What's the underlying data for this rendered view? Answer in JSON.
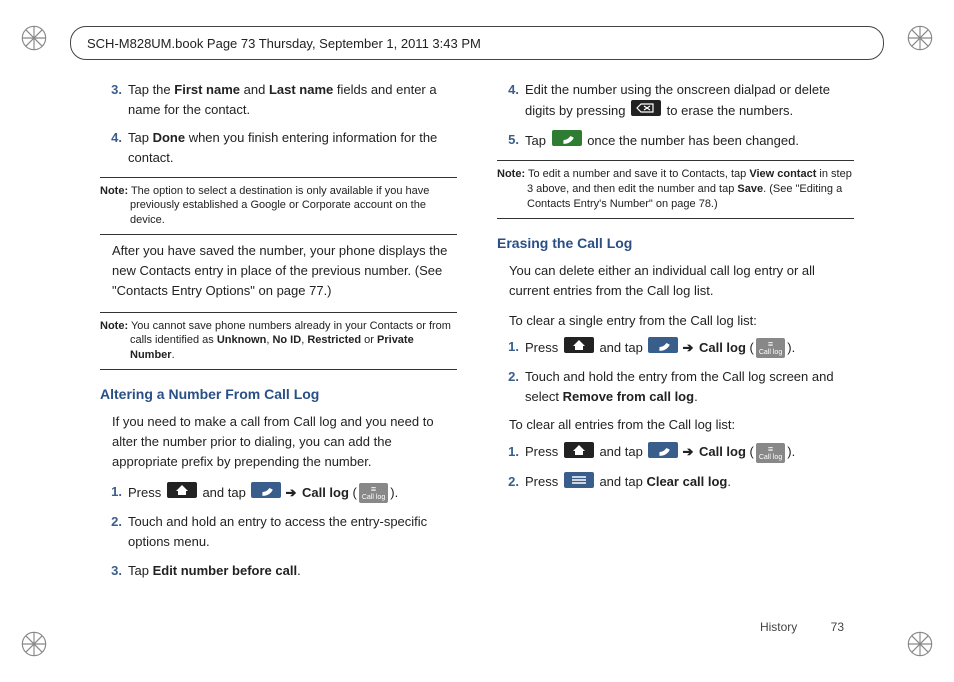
{
  "header": "SCH-M828UM.book  Page 73  Thursday, September 1, 2011  3:43 PM",
  "footer_section": "History",
  "footer_page": "73",
  "left": {
    "step3": {
      "num": "3.",
      "t1": "Tap the ",
      "b1": "First name",
      "t2": " and ",
      "b2": "Last name",
      "t3": " fields and enter a name for the contact."
    },
    "step4": {
      "num": "4.",
      "t1": "Tap ",
      "b1": "Done",
      "t2": " when you finish entering information for the contact."
    },
    "note1": {
      "lbl": "Note:",
      "t": " The option to select a destination is only available if you have previously established a Google or Corporate account on the device."
    },
    "para1": "After you have saved the number, your phone displays the new Contacts entry in place of the previous number. (See \"Contacts Entry Options\" on page 77.)",
    "note2": {
      "lbl": "Note:",
      "t1": " You cannot save phone numbers already in your Contacts or from calls identified as ",
      "b1": "Unknown",
      "c1": ", ",
      "b2": "No ID",
      "c2": ", ",
      "b3": "Restricted",
      "c3": " or ",
      "b4": "Private Number",
      "c4": "."
    },
    "h1": "Altering a Number From Call Log",
    "intro1": "If you need to make a call from Call log and you need to alter the number prior to dialing, you can add the appropriate prefix by prepending the number.",
    "s1": {
      "num": "1.",
      "t1": "Press ",
      "t2": " and tap ",
      "arrow": "➔",
      "b1": " Call log",
      "t3": " (",
      "cl": "Call log",
      "t4": ")."
    },
    "s2": {
      "num": "2.",
      "t": "Touch and hold an entry to access the entry-specific options menu."
    },
    "s3": {
      "num": "3.",
      "t1": "Tap ",
      "b1": "Edit number before call",
      "t2": "."
    }
  },
  "right": {
    "step4": {
      "num": "4.",
      "t1": "Edit the number using the onscreen dialpad or delete digits by pressing ",
      "t2": " to erase the numbers."
    },
    "step5": {
      "num": "5.",
      "t1": "Tap ",
      "t2": " once the number has been changed."
    },
    "note1": {
      "lbl": "Note:",
      "t1": " To edit a number and save it to Contacts, tap ",
      "b1": "View contact",
      "t2": " in step 3 above, and then edit the number and tap ",
      "b2": "Save",
      "t3": ". (See \"Editing a Contacts Entry's Number\" on page 78.)"
    },
    "h1": "Erasing the Call Log",
    "p1": "You can delete either an individual call log entry or all current entries from the Call log list.",
    "intro1": "To clear a single entry from the Call log list:",
    "a1": {
      "num": "1.",
      "t1": "Press ",
      "t2": " and tap ",
      "arrow": "➔",
      "b1": " Call log",
      "t3": " (",
      "cl": "Call log",
      "t4": ")."
    },
    "a2": {
      "num": "2.",
      "t1": "Touch and hold the entry from the Call log screen and select ",
      "b1": "Remove from call log",
      "t2": "."
    },
    "intro2": "To clear all entries from the Call log list:",
    "b1s": {
      "num": "1.",
      "t1": "Press ",
      "t2": " and tap ",
      "arrow": "➔",
      "b1": " Call log",
      "t3": " (",
      "cl": "Call log",
      "t4": ")."
    },
    "b2s": {
      "num": "2.",
      "t1": "Press ",
      "t2": " and tap ",
      "b1": "Clear call log",
      "t3": "."
    }
  }
}
